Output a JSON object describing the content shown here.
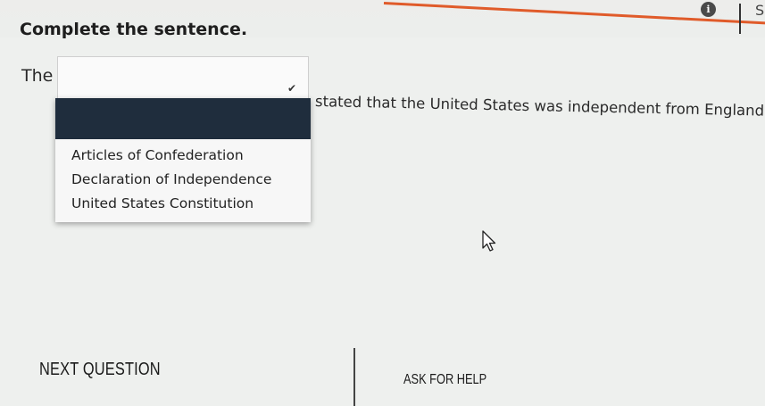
{
  "header": {
    "info_icon_glyph": "i",
    "edge_glyph": "S",
    "accent_color": "#e05b2a"
  },
  "question": {
    "prompt": "Complete the sentence.",
    "sentence_start": "The",
    "sentence_end": "stated that the United States was independent from England.",
    "selected_value": ""
  },
  "dropdown": {
    "options": [
      "Articles of Confederation",
      "Declaration of Independence",
      "United States Constitution"
    ],
    "header_color": "#1f2d3d"
  },
  "footer": {
    "next_label": "NEXT QUESTION",
    "help_label": "ASK FOR HELP"
  }
}
